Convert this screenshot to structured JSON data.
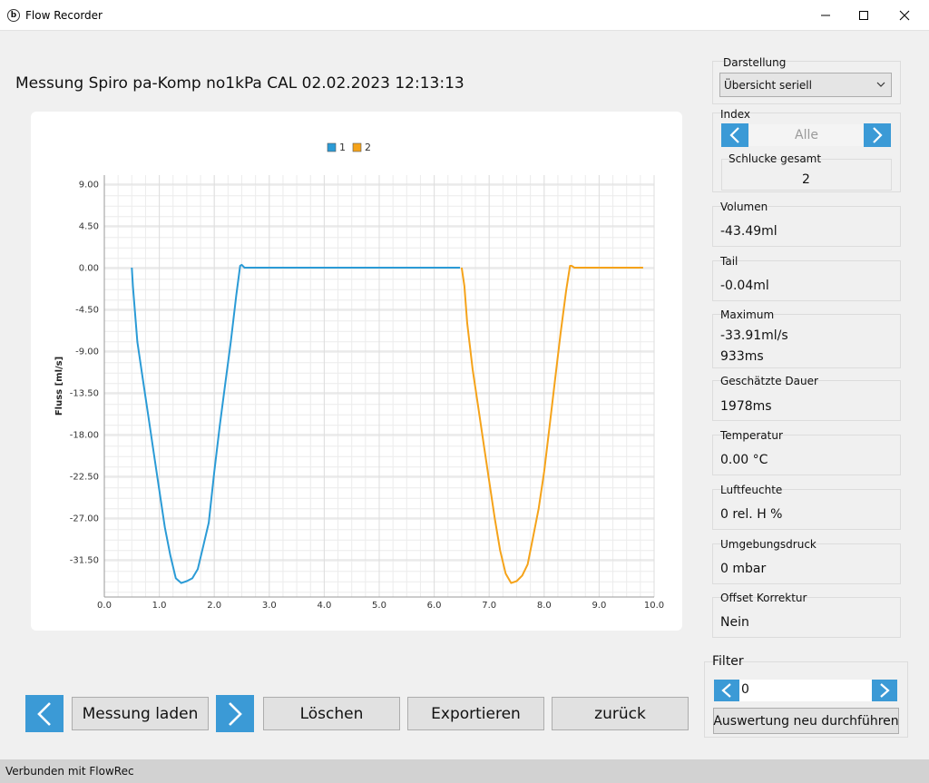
{
  "window": {
    "title": "Flow Recorder",
    "logo_letter": "b"
  },
  "measurement_title": "Messung Spiro pa-Komp no1kPa CAL 02.02.2023 12:13:13",
  "darstellung": {
    "label": "Darstellung",
    "selected": "Übersicht seriell"
  },
  "index": {
    "label": "Index",
    "value": "Alle"
  },
  "schlucke": {
    "label": "Schlucke gesamt",
    "value": "2"
  },
  "stats": [
    {
      "label": "Volumen",
      "value": "-43.49ml"
    },
    {
      "label": "Tail",
      "value": "-0.04ml"
    },
    {
      "label": "Maximum",
      "value": "-33.91ml/s",
      "value2": "933ms"
    },
    {
      "label": "Geschätzte Dauer",
      "value": "1978ms"
    },
    {
      "label": "Temperatur",
      "value": "0.00 °C"
    },
    {
      "label": "Luftfeuchte",
      "value": "0  rel. H %"
    },
    {
      "label": "Umgebungsdruck",
      "value": "0  mbar"
    },
    {
      "label": "Offset Korrektur",
      "value": "Nein"
    }
  ],
  "filter": {
    "label": "Filter",
    "value": "0",
    "rerun_label": "Auswertung neu durchführen"
  },
  "buttons": {
    "load": "Messung laden",
    "delete": "Löschen",
    "export": "Exportieren",
    "back": "zurück"
  },
  "status": "Verbunden mit FlowRec",
  "colors": {
    "series1": "#2b9bd6",
    "series2": "#f5a31a",
    "accent": "#3b9ad6"
  },
  "chart_data": {
    "type": "line",
    "ylabel": "Fluss [ml/s]",
    "xlabel": "",
    "xlim": [
      0,
      10
    ],
    "ylim": [
      -36,
      10
    ],
    "x_ticks": [
      "0.0",
      "1.0",
      "2.0",
      "3.0",
      "4.0",
      "5.0",
      "6.0",
      "7.0",
      "8.0",
      "9.0",
      "10.0"
    ],
    "y_ticks": [
      "9.00",
      "4.50",
      "0.00",
      "-4.50",
      "-9.00",
      "-13.50",
      "-18.00",
      "-22.50",
      "-27.00",
      "-31.50"
    ],
    "grid": true,
    "legend_position": "top-center",
    "series": [
      {
        "name": "1",
        "x": [
          0.5,
          0.52,
          0.6,
          0.7,
          0.8,
          0.9,
          1.0,
          1.1,
          1.2,
          1.3,
          1.4,
          1.5,
          1.6,
          1.7,
          1.8,
          1.9,
          2.0,
          2.1,
          2.2,
          2.3,
          2.4,
          2.47,
          2.5,
          2.55,
          3.0,
          4.0,
          5.0,
          6.0,
          6.4,
          6.47
        ],
        "y": [
          0,
          -2,
          -8,
          -12,
          -16,
          -20,
          -24,
          -28,
          -31,
          -33.5,
          -34,
          -33.8,
          -33.5,
          -32.5,
          -30,
          -27.5,
          -22,
          -17,
          -12.5,
          -8,
          -3,
          0.2,
          0.3,
          0,
          0,
          0,
          0,
          0,
          0,
          0
        ]
      },
      {
        "name": "2",
        "x": [
          6.5,
          6.55,
          6.6,
          6.7,
          6.8,
          6.9,
          7.0,
          7.1,
          7.2,
          7.3,
          7.4,
          7.5,
          7.6,
          7.7,
          7.8,
          7.9,
          8.0,
          8.1,
          8.2,
          8.3,
          8.4,
          8.47,
          8.5,
          8.55,
          9.0,
          9.5,
          9.8
        ],
        "y": [
          0,
          -2,
          -6,
          -11,
          -15,
          -19,
          -23,
          -27,
          -30.5,
          -33,
          -34,
          -33.8,
          -33.2,
          -32,
          -29,
          -26,
          -22,
          -17,
          -12,
          -7,
          -2.5,
          0.2,
          0.2,
          0,
          0,
          0,
          0
        ]
      }
    ]
  }
}
